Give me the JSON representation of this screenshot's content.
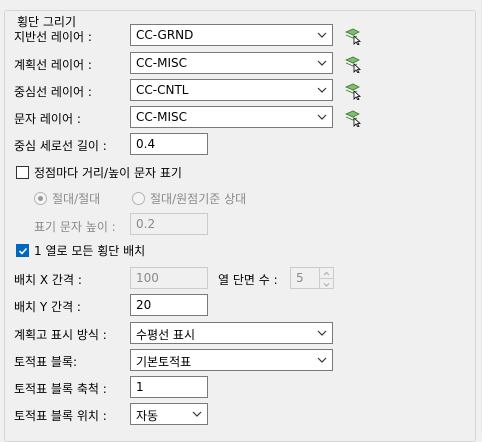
{
  "group_title": "횡단 그리기",
  "layers": [
    {
      "label": "지반선 레이어 :",
      "value": "CC-GRND"
    },
    {
      "label": "계획선 레이어 :",
      "value": "CC-MISC"
    },
    {
      "label": "중심선 레이어 :",
      "value": "CC-CNTL"
    },
    {
      "label": "문자 레이어 :",
      "value": "CC-MISC"
    }
  ],
  "center_vertical_length": {
    "label": "중심 세로선 길이 :",
    "value": "0.4"
  },
  "vertex_text": {
    "checkbox_label": "정점마다 거리/높이 문자 표기",
    "checked": false,
    "radio_absolute": "절대/절대",
    "radio_relative": "절대/원점기준 상대",
    "text_height_label": "표기 문자 높이 :",
    "text_height_value": "0.2"
  },
  "one_row": {
    "checkbox_label": "1 열로 모든 횡단 배치",
    "checked": true
  },
  "spacing_x": {
    "label": "배치 X 간격 :",
    "value": "100"
  },
  "columns": {
    "label": "열 단면 수 :",
    "value": "5"
  },
  "spacing_y": {
    "label": "배치 Y 간격 :",
    "value": "20"
  },
  "elevation_display": {
    "label": "계획고 표시 방식 :",
    "value": "수평선 표시"
  },
  "earthwork_block": {
    "label": "토적표 블록:",
    "value": "기본토적표"
  },
  "earthwork_scale": {
    "label": "토적표 블록 축척 :",
    "value": "1"
  },
  "earthwork_position": {
    "label": "토적표 블록 위치 :",
    "value": "자동"
  },
  "colors": {
    "accent": "#0067c0",
    "border": "#7a7a7a",
    "background": "#f0f0f0",
    "disabled_text": "#8a8a8a"
  },
  "icons": {
    "dropdown": "chevron-down-icon",
    "layer_pick": "layer-pick-cursor-icon",
    "check": "checkmark-icon"
  }
}
